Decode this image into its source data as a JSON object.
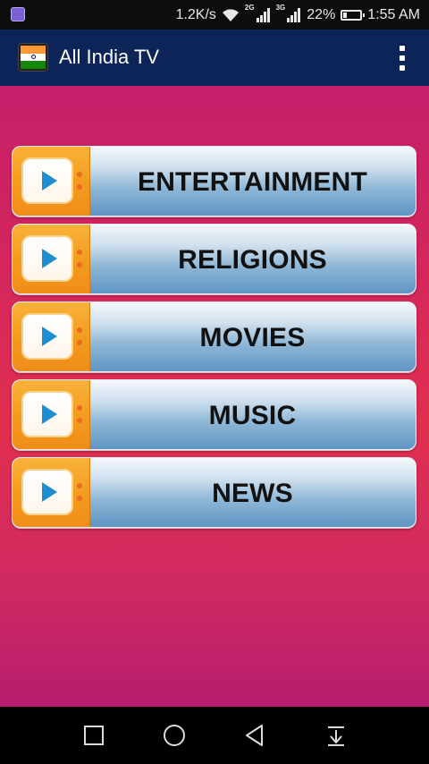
{
  "status_bar": {
    "speed": "1.2K/s",
    "network_tag_1": "2G",
    "network_tag_2": "3G",
    "battery": "22%",
    "time": "1:55 AM",
    "battery_level": 0.22
  },
  "app_bar": {
    "title": "All India TV",
    "logo": "india-flag-icon",
    "overflow_icon": "more-vert-icon"
  },
  "menu": {
    "items": [
      {
        "label": "ENTERTAINMENT",
        "icon": "tv-play-icon"
      },
      {
        "label": "RELIGIONS",
        "icon": "tv-play-icon"
      },
      {
        "label": "MOVIES",
        "icon": "tv-play-icon"
      },
      {
        "label": "MUSIC",
        "icon": "tv-play-icon"
      },
      {
        "label": "NEWS",
        "icon": "tv-play-icon"
      }
    ]
  },
  "nav_bar": {
    "buttons": [
      "recent-apps-icon",
      "home-icon",
      "back-icon",
      "notification-shade-icon"
    ]
  },
  "colors": {
    "app_bar": "#0c2458",
    "background_top": "#c61e6a",
    "background_mid": "#e0304f",
    "button_orange": "#f39c1f",
    "play_blue": "#1f8ed1"
  }
}
